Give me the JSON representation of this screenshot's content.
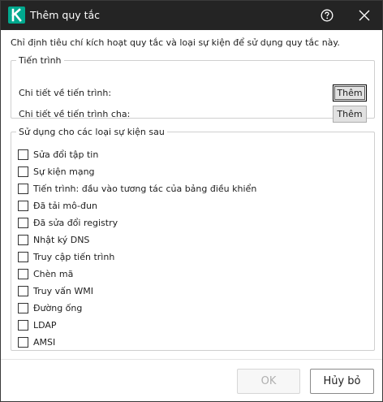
{
  "window": {
    "title": "Thêm quy tắc",
    "logo_icon": "kaspersky-k-logo",
    "help_icon": "help-circle-icon",
    "close_icon": "close-icon",
    "accent_color": "#00a88e",
    "titlebar_color": "#242424"
  },
  "description": "Chỉ định tiêu chí kích hoạt quy tắc và loại sự kiện để sử dụng quy tắc này.",
  "process_group": {
    "legend": "Tiến trình",
    "rows": [
      {
        "label": "Chi tiết về tiến trình:",
        "button": "Thêm"
      },
      {
        "label": "Chi tiết về tiến trình cha:",
        "button": "Thêm"
      }
    ]
  },
  "events_group": {
    "legend": "Sử dụng cho các loại sự kiện sau",
    "items": [
      {
        "label": "Sửa đổi tập tin",
        "checked": false
      },
      {
        "label": "Sự kiện mạng",
        "checked": false
      },
      {
        "label": "Tiến trình: đầu vào tương tác của bảng điều khiển",
        "checked": false
      },
      {
        "label": "Đã tải mô-đun",
        "checked": false
      },
      {
        "label": "Đã sửa đổi registry",
        "checked": false
      },
      {
        "label": "Nhật ký DNS",
        "checked": false
      },
      {
        "label": "Truy cập tiến trình",
        "checked": false
      },
      {
        "label": "Chèn mã",
        "checked": false
      },
      {
        "label": "Truy vấn WMI",
        "checked": false
      },
      {
        "label": "Đường ống",
        "checked": false
      },
      {
        "label": "LDAP",
        "checked": false
      },
      {
        "label": "AMSI",
        "checked": false
      }
    ]
  },
  "footer": {
    "ok_label": "OK",
    "ok_enabled": false,
    "cancel_label": "Hủy bỏ"
  }
}
